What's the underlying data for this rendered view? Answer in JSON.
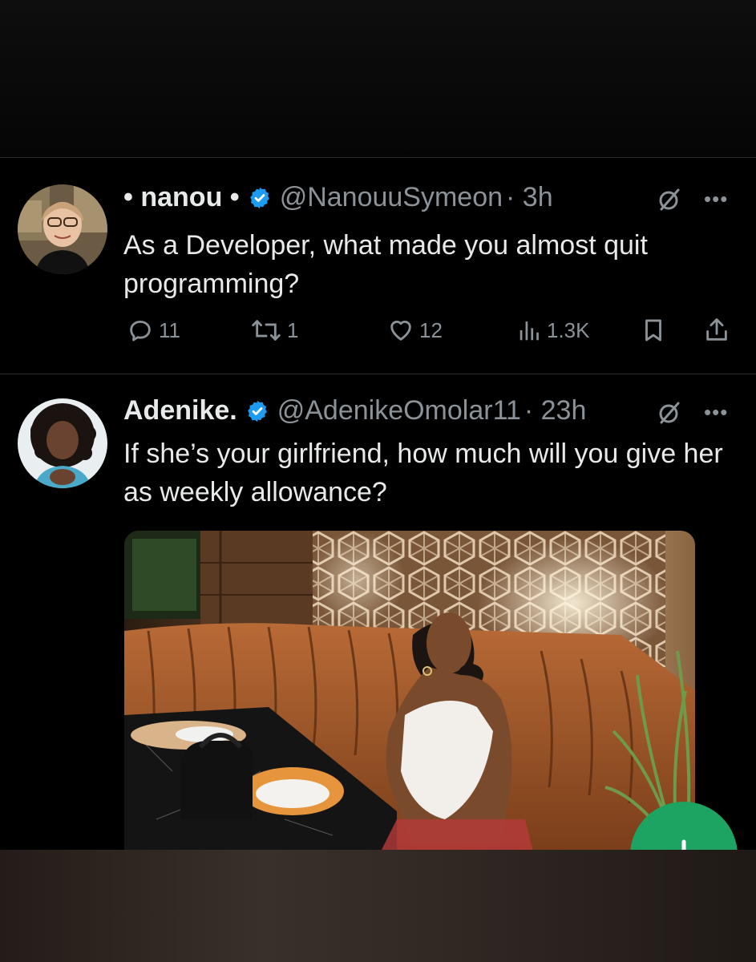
{
  "tweets": [
    {
      "name": "• nanou •",
      "handle": "@NanouuSymeon",
      "time": "· 3h",
      "text": "As a Developer, what made you almost quit programming?",
      "stats": {
        "replies": "11",
        "reposts": "1",
        "likes": "12",
        "views": "1.3K"
      }
    },
    {
      "name": "Adenike.",
      "handle": "@AdenikeOmolar11",
      "time": "· 23h",
      "text": "If she’s your girlfriend, how much will you give her as weekly allowance?"
    }
  ],
  "icons": {
    "verified": "verified-badge-icon",
    "grok": "grok-icon",
    "more": "more-icon",
    "reply": "reply-icon",
    "repost": "repost-icon",
    "like": "heart-icon",
    "views": "views-icon",
    "bookmark": "bookmark-icon",
    "share": "share-icon"
  },
  "colors": {
    "background": "#000000",
    "text": "#e7e9ea",
    "secondary": "#8b9298",
    "verified": "#1d9bf0",
    "fab": "#1da462"
  }
}
